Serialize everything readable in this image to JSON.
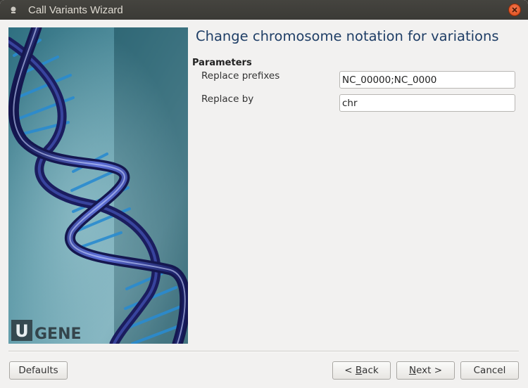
{
  "window": {
    "title": "Call Variants Wizard"
  },
  "banner": {
    "logo_letter": "U",
    "logo_text": "GENE"
  },
  "page": {
    "title": "Change chromosome notation for variations",
    "section_header": "Parameters"
  },
  "params": [
    {
      "label": "Replace prefixes",
      "value": "NC_00000;NC_0000"
    },
    {
      "label": "Replace by",
      "value": "chr"
    }
  ],
  "buttons": {
    "defaults": "Defaults",
    "back_prefix": "< ",
    "back_mnemonic": "B",
    "back_rest": "ack",
    "next_mnemonic": "N",
    "next_rest": "ext >",
    "cancel": "Cancel"
  },
  "colors": {
    "title_blue": "#1f3e66",
    "close_orange": "#dd4814",
    "window_bg": "#f2f1f0"
  },
  "icons": {
    "app": "app-icon",
    "close": "close-icon"
  }
}
